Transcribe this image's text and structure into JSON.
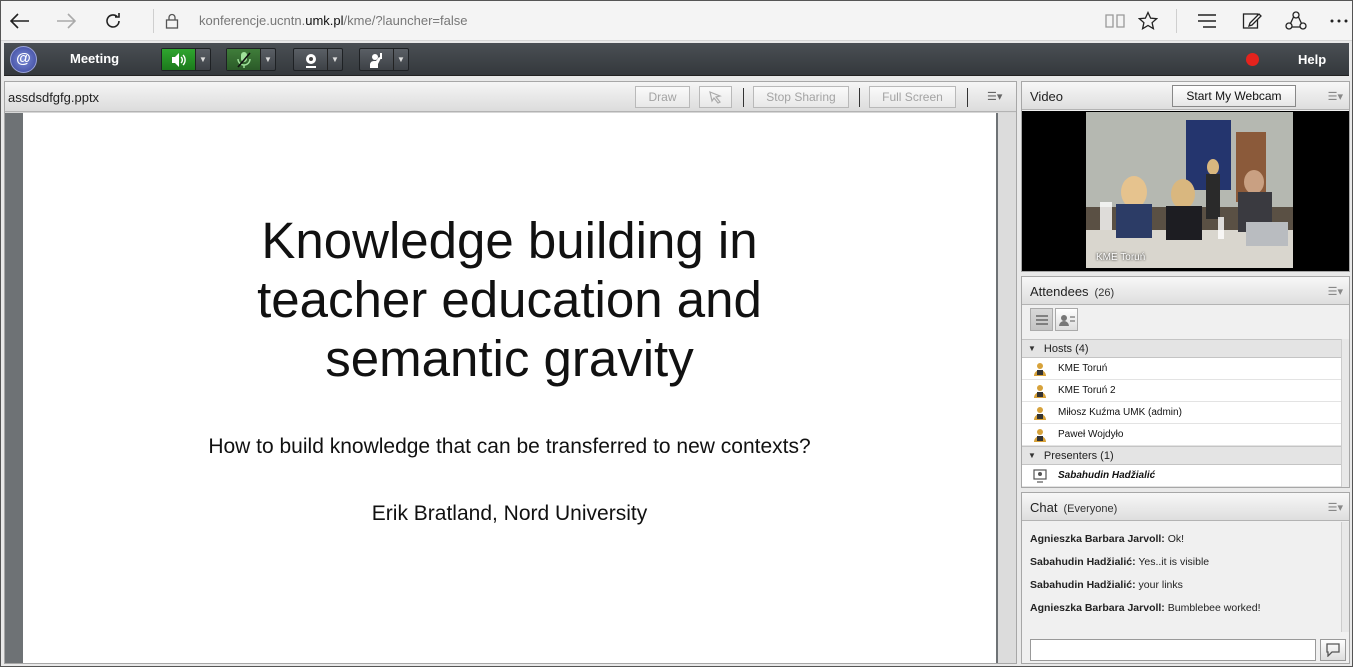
{
  "browser": {
    "url_prefix": "konferencje.ucntn.",
    "url_domain": "umk.pl",
    "url_suffix": "/kme/?launcher=false"
  },
  "meeting": {
    "menu_label": "Meeting",
    "help_label": "Help"
  },
  "share": {
    "filename": "assdsdfgfg.pptx",
    "draw_label": "Draw",
    "stop_sharing_label": "Stop Sharing",
    "full_screen_label": "Full Screen"
  },
  "slide": {
    "title_line1": "Knowledge building in",
    "title_line2": "teacher education and",
    "title_line3": "semantic gravity",
    "subtitle": "How to build knowledge that can be transferred to new contexts?",
    "author": "Erik Bratland, Nord University"
  },
  "video": {
    "title": "Video",
    "webcam_button": "Start My Webcam",
    "feed_label": "KME Toruń"
  },
  "attendees": {
    "title": "Attendees",
    "count": "(26)",
    "hosts_label": "Hosts (4)",
    "hosts": [
      "KME Toruń",
      "KME Toruń 2",
      "Miłosz Kuźma UMK (admin)",
      "Paweł Wojdyło"
    ],
    "presenters_label": "Presenters (1)",
    "presenters": [
      "Sabahudin  Hadžialić"
    ]
  },
  "chat": {
    "title": "Chat",
    "scope": "(Everyone)",
    "messages": [
      {
        "author": "Agnieszka Barbara Jarvoll:",
        "text": " Ok!"
      },
      {
        "author": "Sabahudin  Hadžialić:",
        "text": " Yes..it is visible"
      },
      {
        "author": "Sabahudin  Hadžialić:",
        "text": " your links"
      },
      {
        "author": "Agnieszka Barbara Jarvoll:",
        "text": " Bumblebee worked!"
      }
    ]
  },
  "colors": {
    "record": "#e5231d",
    "speaker_on": "#2fa52f",
    "toolbar": "#3d4146"
  }
}
